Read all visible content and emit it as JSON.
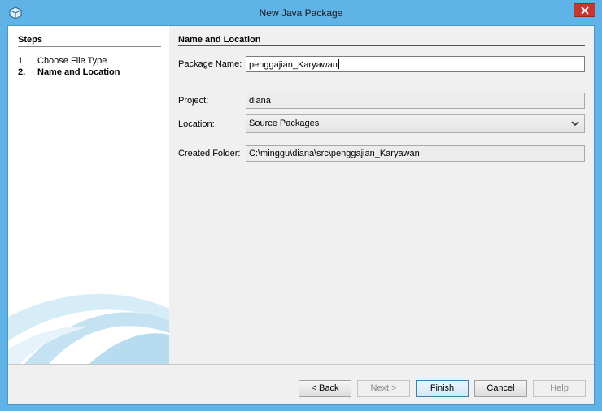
{
  "window": {
    "title": "New Java Package"
  },
  "steps": {
    "heading": "Steps",
    "items": [
      {
        "num": "1.",
        "label": "Choose File Type"
      },
      {
        "num": "2.",
        "label": "Name and Location"
      }
    ]
  },
  "form": {
    "heading": "Name and Location",
    "package_name_label": "Package Name:",
    "package_name_value": "penggajian_Karyawan",
    "project_label": "Project:",
    "project_value": "diana",
    "location_label": "Location:",
    "location_value": "Source Packages",
    "created_folder_label": "Created Folder:",
    "created_folder_value": "C:\\minggu\\diana\\src\\penggajian_Karyawan"
  },
  "buttons": {
    "back": "< Back",
    "next": "Next >",
    "finish": "Finish",
    "cancel": "Cancel",
    "help": "Help"
  },
  "colors": {
    "frame": "#5fb3e6",
    "close": "#c7372f",
    "primary_border": "#3c7fb1"
  }
}
